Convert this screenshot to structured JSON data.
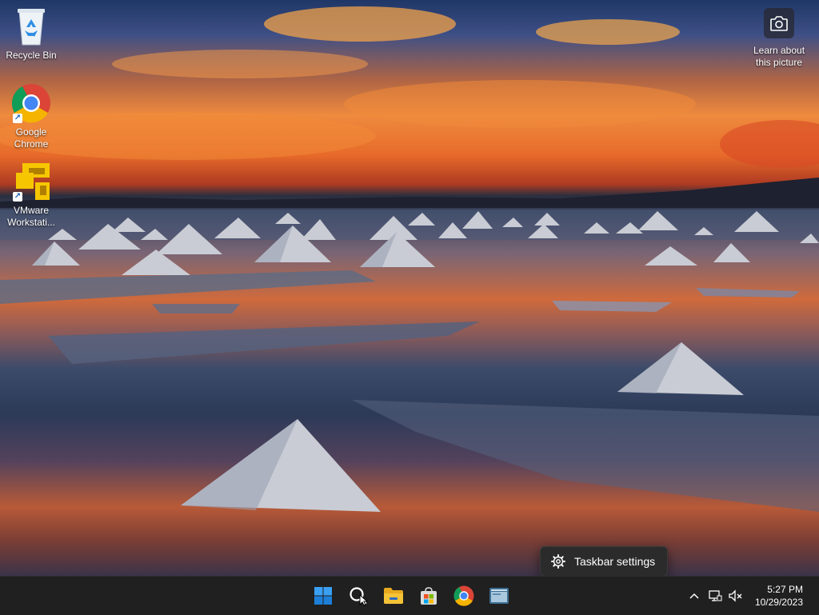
{
  "desktop": {
    "icons": [
      {
        "label": "Recycle Bin",
        "icon": "recycle-bin-icon"
      },
      {
        "label_line1": "Google",
        "label_line2": "Chrome",
        "icon": "chrome-icon"
      },
      {
        "label_line1": "VMware",
        "label_line2": "Workstati...",
        "icon": "vmware-icon"
      }
    ],
    "learn_line1": "Learn about",
    "learn_line2": "this picture",
    "learn_icon": "camera-icon"
  },
  "context_menu": {
    "item_label": "Taskbar settings",
    "item_icon": "gear-icon"
  },
  "taskbar": {
    "apps": [
      {
        "name": "start",
        "icon": "windows-start-icon"
      },
      {
        "name": "search",
        "icon": "search-icon"
      },
      {
        "name": "file-explorer",
        "icon": "folder-icon"
      },
      {
        "name": "microsoft-store",
        "icon": "store-icon"
      },
      {
        "name": "chrome",
        "icon": "chrome-icon"
      },
      {
        "name": "vmware",
        "icon": "vmware-icon"
      }
    ],
    "tray": {
      "time": "5:27 PM",
      "date": "10/29/2023"
    }
  },
  "colors": {
    "taskbar_bg": "#202020",
    "accent_blue": "#0078d4",
    "folder_yellow": "#f4c236",
    "vmware_yellow": "#f6c700"
  }
}
